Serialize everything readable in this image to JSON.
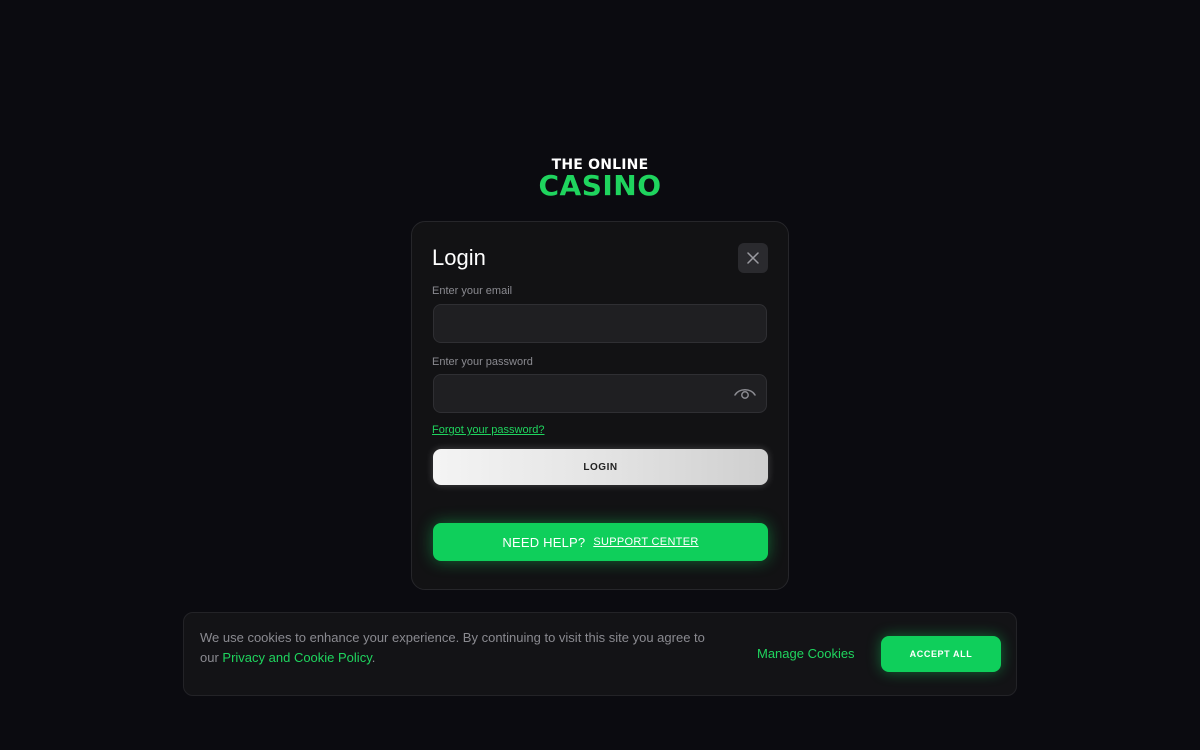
{
  "brand": {
    "logo_top": "THE ONLINE",
    "logo_bottom": "CASINO",
    "accent_color": "#1fd45e"
  },
  "login": {
    "title": "Login",
    "close_icon": "close-icon",
    "email_label": "Enter your email",
    "email_value": "",
    "password_label": "Enter your password",
    "password_value": "",
    "show_password_icon": "eye-icon",
    "forgot_password": "Forgot your password?",
    "login_button": "LOGIN",
    "help_text": "NEED HELP?",
    "support_link": "SUPPORT CENTER"
  },
  "cookies": {
    "text_prefix": "We use cookies to enhance your experience. By continuing to visit this site you agree to our ",
    "policy_link": "Privacy and Cookie Policy",
    "text_suffix": ".",
    "manage": "Manage Cookies",
    "accept": "ACCEPT ALL"
  }
}
